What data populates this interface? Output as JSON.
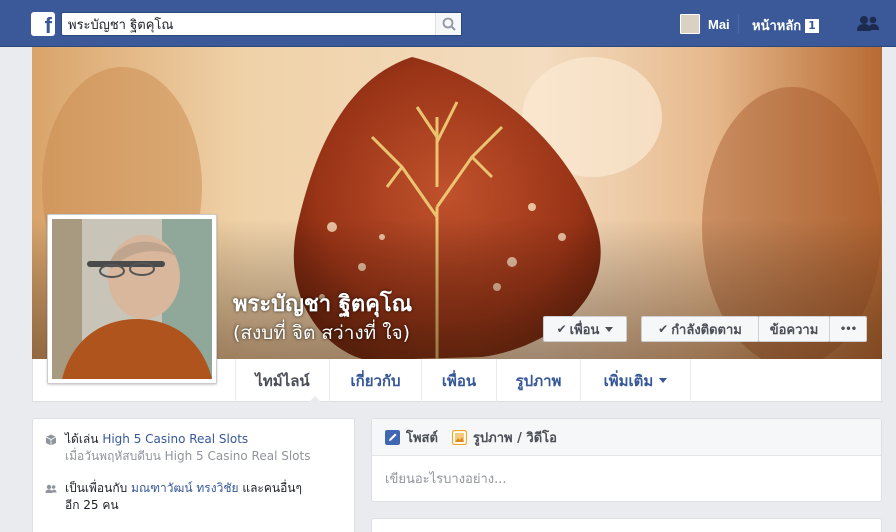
{
  "topbar": {
    "logo_letter": "f",
    "search_value": "พระบัญชา ฐิตคุโณ",
    "user_name": "Mai",
    "home_label": "หน้าหลัก",
    "home_badge": "1"
  },
  "profile": {
    "name": "พระบัญชา ฐิตคุโณ",
    "alternate_name": "(สงบที่ จิต สว่างที่ ใจ)"
  },
  "actions": {
    "friends_label": "เพื่อน",
    "following_label": "กำลังติดตาม",
    "message_label": "ข้อความ",
    "more_label": "•••"
  },
  "tabs": [
    {
      "label": "ไทม์ไลน์",
      "active": true
    },
    {
      "label": "เกี่ยวกับ",
      "active": false
    },
    {
      "label": "เพื่อน",
      "active": false
    },
    {
      "label": "รูปภาพ",
      "active": false
    },
    {
      "label": "เพิ่มเติม",
      "active": false
    }
  ],
  "activity": [
    {
      "icon": "cube-icon",
      "prefix": "ได้เล่น ",
      "link": "High 5 Casino Real Slots",
      "suffix": "",
      "sub": "เมื่อวันพฤหัสบดีบน High 5 Casino Real Slots"
    },
    {
      "icon": "friends-icon",
      "prefix": "เป็นเพื่อนกับ ",
      "link": "มณฑาวัฒน์ ทรงวิชัย",
      "suffix": " และคนอื่นๆ",
      "sub": "อีก 25 คน"
    }
  ],
  "composer": {
    "post_label": "โพสต์",
    "photo_label": "รูปภาพ / วิดีโอ",
    "placeholder": "เขียนอะไรบางอย่าง..."
  },
  "colors": {
    "brand_blue": "#3b5998",
    "link_blue": "#365899",
    "page_bg": "#e9ebee"
  }
}
